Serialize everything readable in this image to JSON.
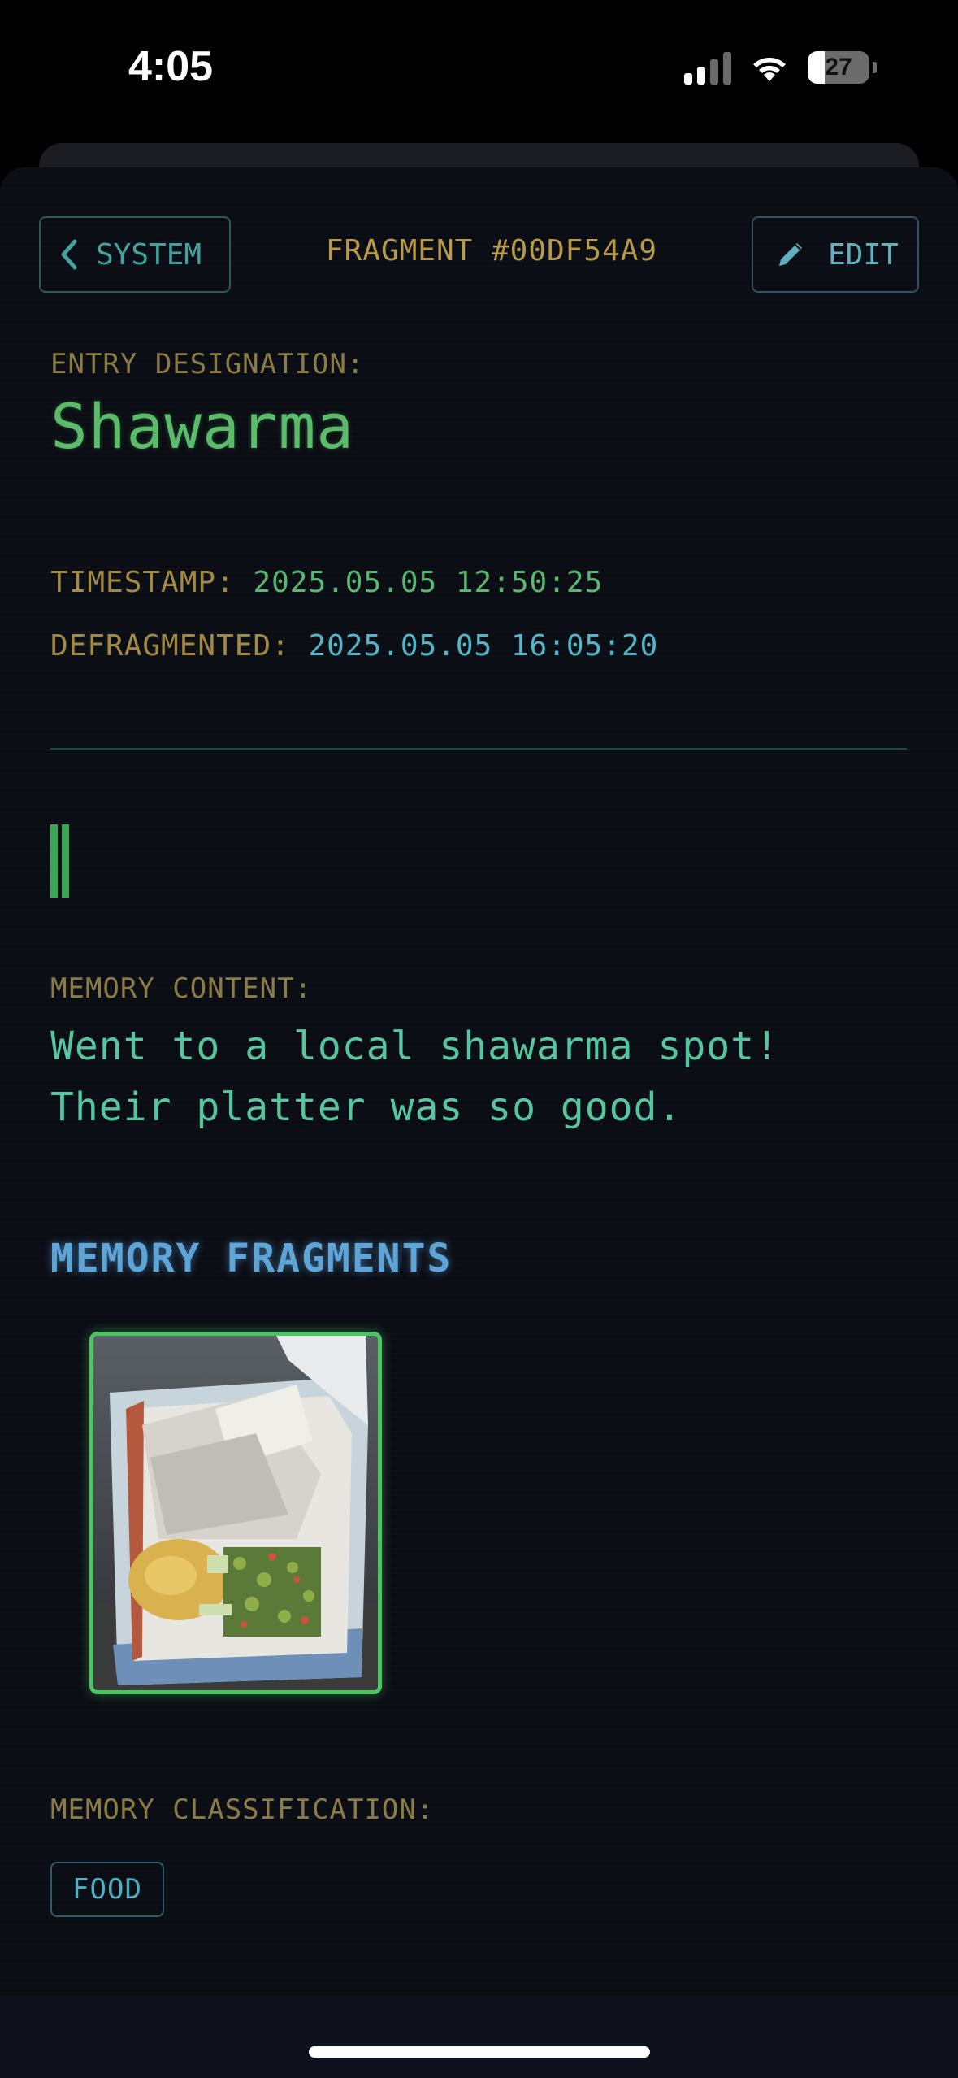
{
  "status_bar": {
    "time": "4:05",
    "battery": "27",
    "battery_level": 0.27,
    "signal_icon": "cellular-signal-icon",
    "wifi_icon": "wifi-icon"
  },
  "header": {
    "back_label": "SYSTEM",
    "back_icon": "chevron-left-icon",
    "title": "FRAGMENT #00DF54A9",
    "edit_label": "EDIT",
    "edit_icon": "pencil-icon"
  },
  "entry": {
    "designation_label": "ENTRY DESIGNATION:",
    "name": "Shawarma",
    "timestamp_label": "TIMESTAMP:",
    "timestamp_value": "2025.05.05 12:50:25",
    "defragmented_label": "DEFRAGMENTED:",
    "defragmented_value": "2025.05.05 16:05:20"
  },
  "memory": {
    "content_label": "MEMORY CONTENT:",
    "content_line1": "Went to a local shawarma spot!",
    "content_line2": "Their platter was so good.",
    "fragments_heading": "MEMORY FRAGMENTS",
    "classification_label": "MEMORY CLASSIFICATION:",
    "classification_tag": "FOOD"
  },
  "colors": {
    "background": "#0b0d14",
    "accent_green": "#5bbb6a",
    "accent_cyan": "#4fb7c8",
    "label_gold": "#8b7b45",
    "heading_blue": "#5fa4d6"
  }
}
